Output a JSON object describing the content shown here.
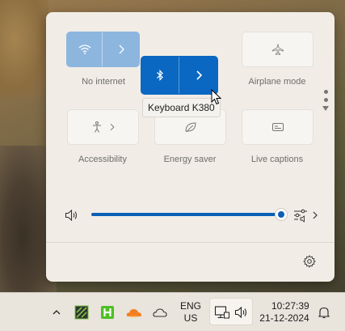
{
  "quick_settings": {
    "tiles": {
      "wifi": {
        "label": "No internet",
        "icon": "wifi-icon"
      },
      "bluetooth": {
        "tooltip": "Keyboard K380",
        "icon": "bluetooth-icon"
      },
      "airplane": {
        "label": "Airplane mode",
        "icon": "airplane-icon"
      },
      "accessibility": {
        "label": "Accessibility",
        "icon": "accessibility-icon"
      },
      "energy_saver": {
        "label": "Energy saver",
        "icon": "leaf-icon"
      },
      "live_captions": {
        "label": "Live captions",
        "icon": "captions-icon"
      }
    },
    "volume": {
      "level": 100,
      "icon": "speaker-icon"
    },
    "accent_color": "#0a67c2"
  },
  "taskbar": {
    "language": {
      "line1": "ENG",
      "line2": "US"
    },
    "clock": {
      "time": "10:27:39",
      "date": "21-12-2024"
    }
  }
}
